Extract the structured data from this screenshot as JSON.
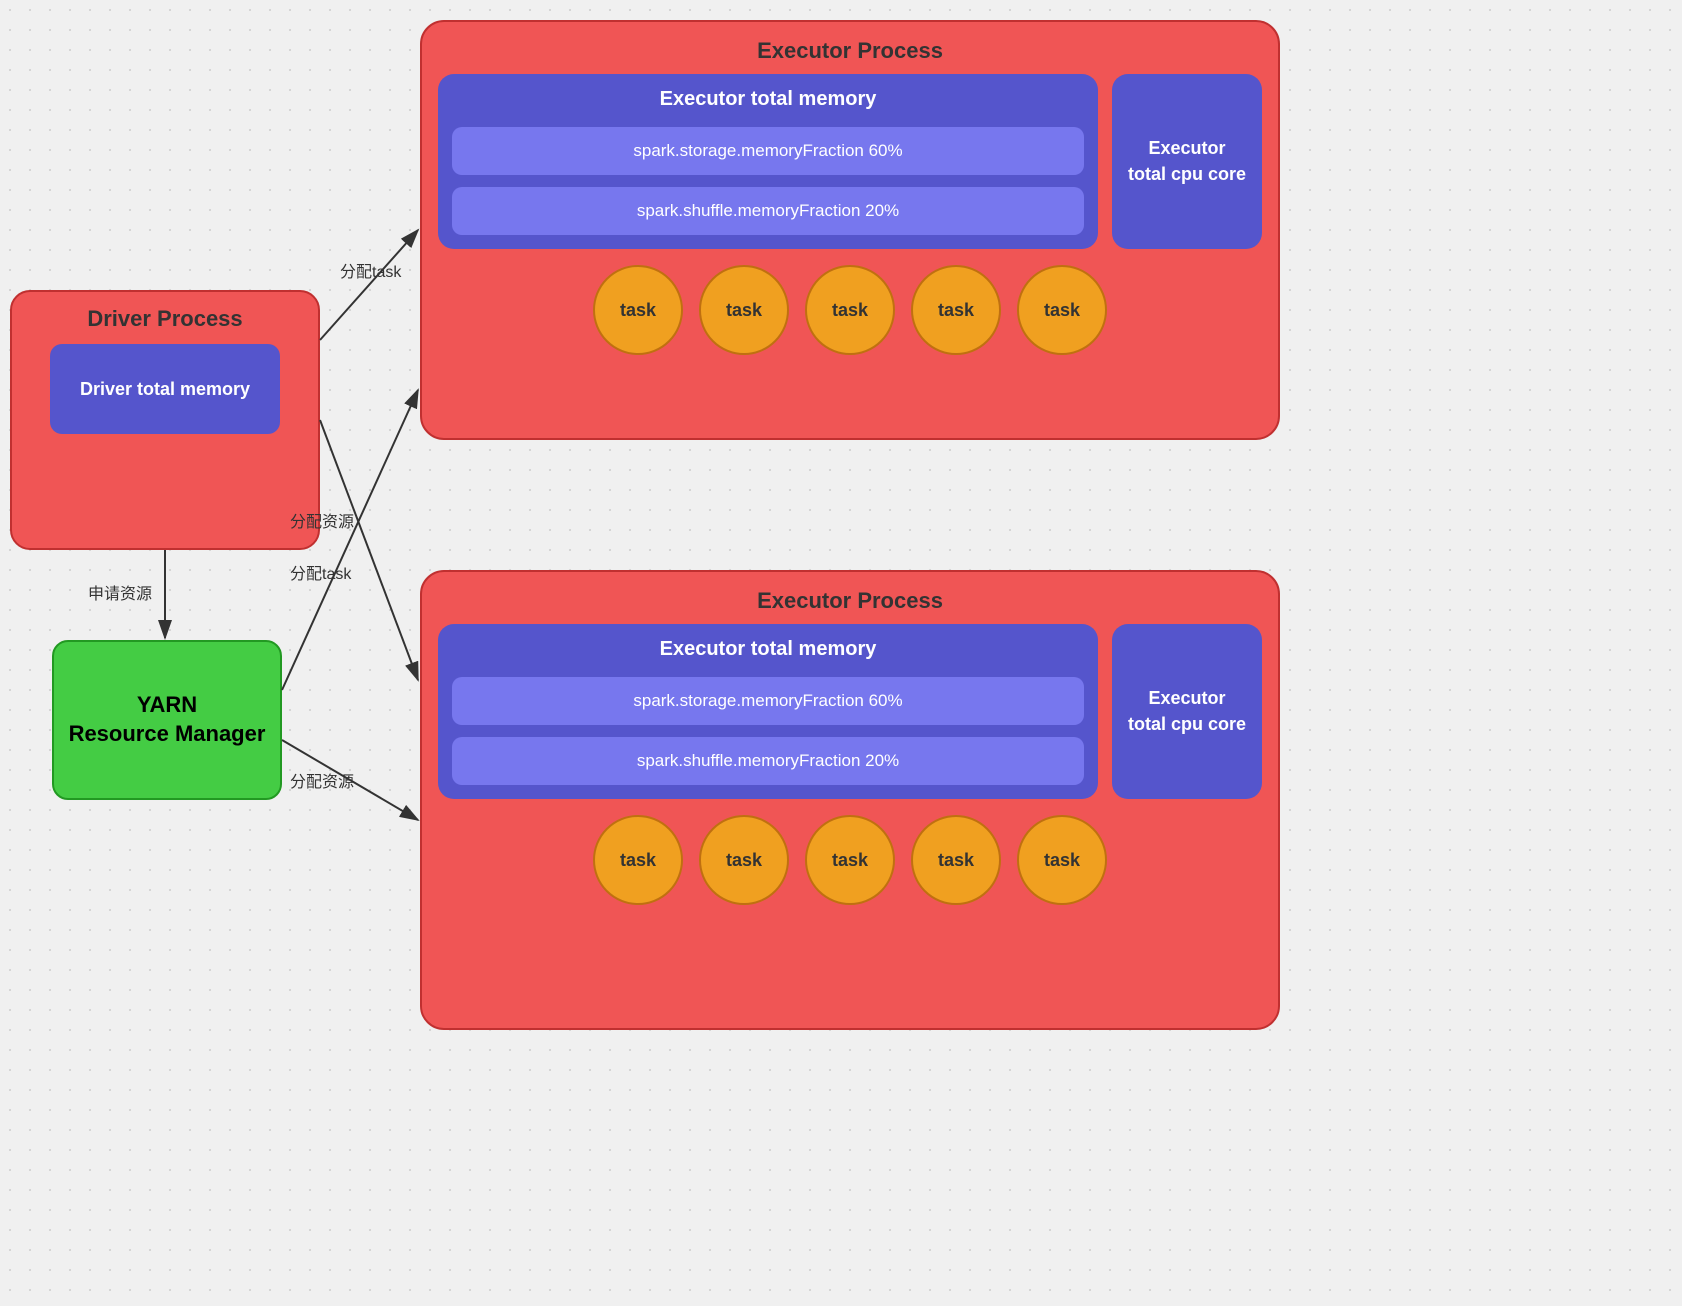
{
  "driver": {
    "process_label": "Driver Process",
    "memory_label": "Driver total memory"
  },
  "yarn": {
    "label": "YARN\nResource Manager"
  },
  "executor_top": {
    "title": "Executor Process",
    "memory_title": "Executor total memory",
    "cpu_label": "Executor\ntotal cpu core",
    "fraction1": "spark.storage.memoryFraction 60%",
    "fraction2": "spark.shuffle.memoryFraction 20%",
    "tasks": [
      "task",
      "task",
      "task",
      "task",
      "task"
    ]
  },
  "executor_bottom": {
    "title": "Executor Process",
    "memory_title": "Executor total memory",
    "cpu_label": "Executor\ntotal cpu core",
    "fraction1": "spark.storage.memoryFraction 60%",
    "fraction2": "spark.shuffle.memoryFraction 20%",
    "tasks": [
      "task",
      "task",
      "task",
      "task",
      "task"
    ]
  },
  "arrow_labels": {
    "distribute_task1": "分配task",
    "apply_resources": "申请资源",
    "distribute_resources1": "分配资源",
    "distribute_task2": "分配task",
    "distribute_resources2": "分配资源"
  }
}
